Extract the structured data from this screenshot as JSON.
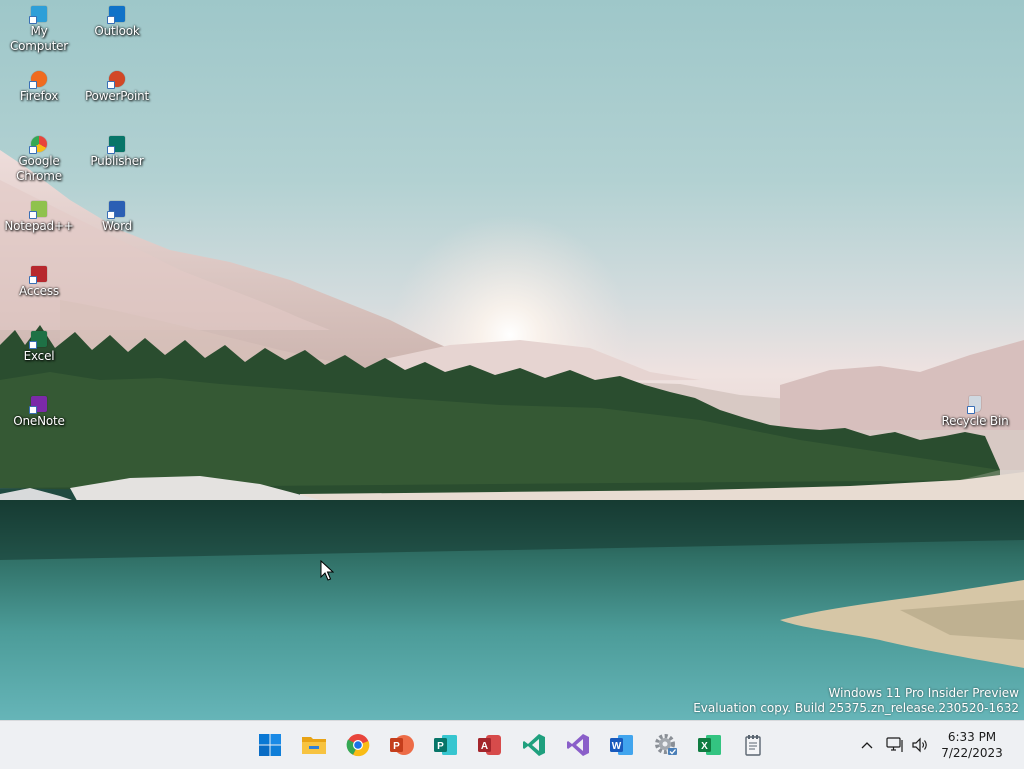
{
  "desktop": {
    "icons": [
      {
        "id": "my-computer",
        "label": "My Computer",
        "icon": "computer-icon",
        "color": "#2e9fd8"
      },
      {
        "id": "outlook",
        "label": "Outlook",
        "icon": "outlook-icon",
        "color": "#1072c8"
      },
      {
        "id": "firefox",
        "label": "Firefox",
        "icon": "firefox-icon",
        "color": "#f06b1f"
      },
      {
        "id": "powerpoint",
        "label": "PowerPoint",
        "icon": "powerpoint-icon",
        "color": "#d24726"
      },
      {
        "id": "google-chrome",
        "label": "Google Chrome",
        "icon": "chrome-icon",
        "color": "#e8453c"
      },
      {
        "id": "publisher",
        "label": "Publisher",
        "icon": "publisher-icon",
        "color": "#077568"
      },
      {
        "id": "notepad-plus-plus",
        "label": "Notepad++",
        "icon": "notepad-icon",
        "color": "#8fc24d"
      },
      {
        "id": "word",
        "label": "Word",
        "icon": "word-icon",
        "color": "#2b5fb4"
      },
      {
        "id": "access",
        "label": "Access",
        "icon": "access-icon",
        "color": "#b7282e"
      },
      {
        "id": "excel",
        "label": "Excel",
        "icon": "excel-icon",
        "color": "#1e7145"
      },
      {
        "id": "onenote",
        "label": "OneNote",
        "icon": "onenote-icon",
        "color": "#7b2aa8"
      },
      {
        "id": "recycle-bin",
        "label": "Recycle Bin",
        "icon": "recycle-bin-icon",
        "color": "#cfd8e0"
      }
    ]
  },
  "watermark": {
    "line1": "Windows 11 Pro Insider Preview",
    "line2": "Evaluation copy. Build 25375.zn_release.230520-1632"
  },
  "taskbar": {
    "apps": [
      {
        "id": "start",
        "icon": "windows-start-icon",
        "color": "#0a78d4"
      },
      {
        "id": "file-explorer",
        "icon": "file-explorer-icon",
        "color": "#f4b925"
      },
      {
        "id": "chrome",
        "icon": "chrome-icon",
        "color": "#e8453c"
      },
      {
        "id": "powerpoint",
        "icon": "powerpoint-icon",
        "color": "#d24726"
      },
      {
        "id": "publisher",
        "icon": "publisher-icon",
        "color": "#077568"
      },
      {
        "id": "access",
        "icon": "access-icon",
        "color": "#b7282e"
      },
      {
        "id": "vscode",
        "icon": "vscode-icon",
        "color": "#1fa07e"
      },
      {
        "id": "visual-studio",
        "icon": "visual-studio-icon",
        "color": "#8a5fc9"
      },
      {
        "id": "word",
        "icon": "word-icon",
        "color": "#2b5fb4"
      },
      {
        "id": "settings",
        "icon": "settings-icon",
        "color": "#8a8f96"
      },
      {
        "id": "excel",
        "icon": "excel-icon",
        "color": "#1e7145"
      },
      {
        "id": "notepad",
        "icon": "notepad-icon",
        "color": "#5a6570"
      }
    ],
    "tray": {
      "chevron_icon": "chevron-up-icon",
      "network_icon": "network-icon",
      "volume_icon": "volume-icon",
      "time": "6:33 PM",
      "date": "7/22/2023"
    }
  }
}
